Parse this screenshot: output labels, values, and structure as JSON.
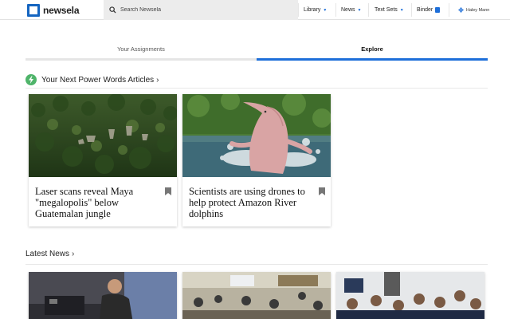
{
  "brand": {
    "name": "newsela"
  },
  "search": {
    "placeholder": "Search Newsela"
  },
  "nav": {
    "library": "Library",
    "news": "News",
    "text_sets": "Text Sets",
    "binder": "Binder",
    "user_name": "Haley Mann"
  },
  "tabs": {
    "assignments": "Your Assignments",
    "explore": "Explore",
    "active": "Explore"
  },
  "power_words": {
    "heading": "Your Next Power Words Articles",
    "articles": [
      {
        "title": "Laser scans reveal Maya \"megalopolis\" below Guatemalan jungle"
      },
      {
        "title": "Scientists are using drones to help protect Amazon River dolphins"
      }
    ]
  },
  "latest_news": {
    "heading": "Latest News"
  },
  "colors": {
    "brand_blue": "#1565c0",
    "accent_blue": "#1e6fd9",
    "power_green": "#4fb46a"
  },
  "icons": {
    "search": "magnifier",
    "dropdown": "caret-down",
    "binder": "book",
    "settings": "gear",
    "power_words": "lightning-bolt",
    "more": "chevron-right",
    "save": "bookmark"
  }
}
